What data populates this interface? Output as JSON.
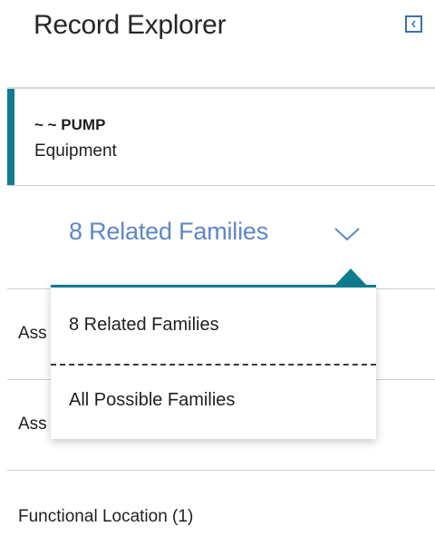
{
  "header": {
    "title": "Record Explorer",
    "collapse_icon": "chevron-left-icon"
  },
  "record": {
    "name": "~ ~ PUMP",
    "family": "Equipment",
    "accent_color": "#0f7c90"
  },
  "family_selector": {
    "selected": "8 Related Families",
    "icon": "chevron-down-icon",
    "color": "#5f86c7"
  },
  "dropdown": {
    "options": [
      {
        "label": "8 Related Families"
      },
      {
        "label": "All Possible Families"
      }
    ]
  },
  "list": {
    "items": [
      {
        "label": "Ass"
      },
      {
        "label": "Ass"
      },
      {
        "label": "Functional Location (1)"
      }
    ]
  }
}
